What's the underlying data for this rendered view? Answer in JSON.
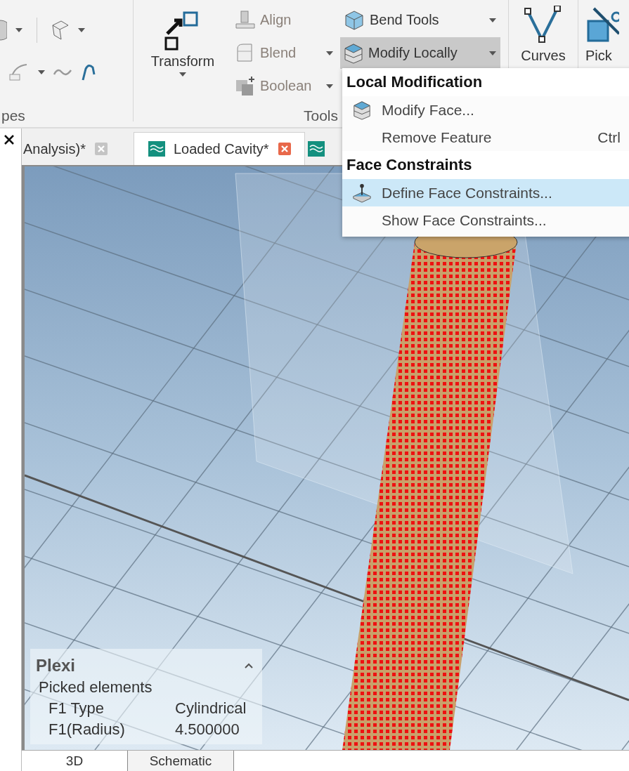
{
  "ribbon": {
    "shapes_group": {
      "label": "pes"
    },
    "tools_group": {
      "label": "Tools",
      "transform": {
        "label": "Transform"
      },
      "small_buttons": [
        {
          "label": "Align",
          "dropdown": false,
          "disabled": true,
          "pressed": false
        },
        {
          "label": "Blend",
          "dropdown": true,
          "disabled": true,
          "pressed": false
        },
        {
          "label": "Boolean",
          "dropdown": true,
          "disabled": true,
          "pressed": false
        },
        {
          "label": "Bend Tools",
          "dropdown": true,
          "disabled": false,
          "pressed": false
        },
        {
          "label": "Modify Locally",
          "dropdown": true,
          "disabled": false,
          "pressed": true
        }
      ]
    },
    "curves": {
      "label": "Curves"
    },
    "picks": {
      "label": "Pick"
    }
  },
  "document_tabs": [
    {
      "label": "Analysis)*",
      "selected": false
    },
    {
      "label": "Loaded Cavity*",
      "selected": true
    },
    {
      "selected": false
    }
  ],
  "dropdown_menu": {
    "sections": [
      {
        "heading": "Local Modification",
        "items": [
          {
            "label": "Modify Face...",
            "icon": true,
            "selected": false
          },
          {
            "label": "Remove Feature",
            "shortcut": "Ctrl",
            "icon": false,
            "selected": false
          }
        ]
      },
      {
        "heading": "Face Constraints",
        "items": [
          {
            "label": "Define Face Constraints...",
            "icon": true,
            "selected": true
          },
          {
            "label": "Show Face Constraints...",
            "icon": false,
            "selected": false
          }
        ]
      }
    ]
  },
  "info_panel": {
    "title": "Plexi",
    "subtitle": "Picked elements",
    "rows": [
      {
        "name": "F1 Type",
        "value": "Cylindrical"
      },
      {
        "name": "F1(Radius)",
        "value": "4.500000"
      }
    ]
  },
  "view_tabs": [
    {
      "label": "3D",
      "selected": true
    },
    {
      "label": "Schematic",
      "selected": false
    }
  ]
}
